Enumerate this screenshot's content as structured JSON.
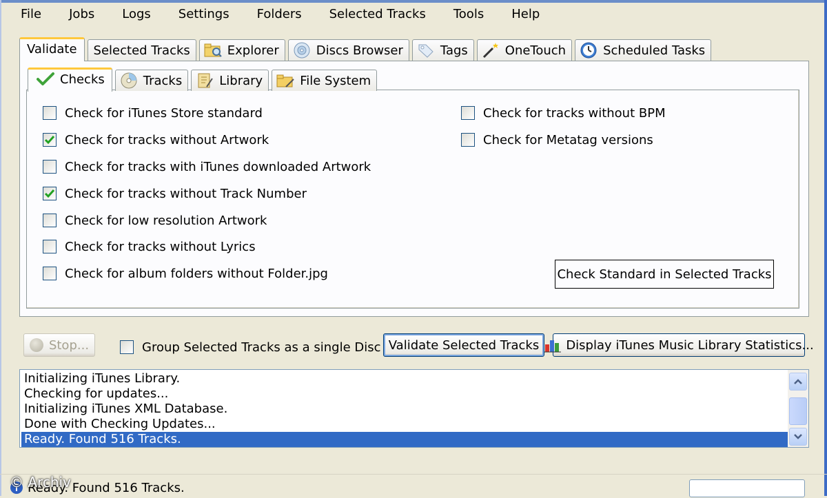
{
  "menu": [
    "File",
    "Jobs",
    "Logs",
    "Settings",
    "Folders",
    "Selected Tracks",
    "Tools",
    "Help"
  ],
  "outer_tabs": [
    {
      "label": "Validate",
      "icon": "none",
      "active": true
    },
    {
      "label": "Selected Tracks",
      "icon": "none"
    },
    {
      "label": "Explorer",
      "icon": "explorer-icon"
    },
    {
      "label": "Discs Browser",
      "icon": "disc-icon"
    },
    {
      "label": "Tags",
      "icon": "tag-icon"
    },
    {
      "label": "OneTouch",
      "icon": "magic-wand-icon"
    },
    {
      "label": "Scheduled Tasks",
      "icon": "clock-icon"
    }
  ],
  "inner_tabs": [
    {
      "label": "Checks",
      "icon": "checkmark-icon",
      "active": true
    },
    {
      "label": "Tracks",
      "icon": "cd-icon"
    },
    {
      "label": "Library",
      "icon": "library-icon"
    },
    {
      "label": "File System",
      "icon": "folder-icon"
    }
  ],
  "checks_left": [
    {
      "label": "Check for iTunes Store standard",
      "checked": false
    },
    {
      "label": "Check for tracks without Artwork",
      "checked": true
    },
    {
      "label": "Check for tracks with iTunes downloaded Artwork",
      "checked": false
    },
    {
      "label": "Check for tracks without Track Number",
      "checked": true
    },
    {
      "label": "Check for low resolution Artwork",
      "checked": false
    },
    {
      "label": "Check for tracks without Lyrics",
      "checked": false
    },
    {
      "label": "Check for album folders without Folder.jpg",
      "checked": false
    }
  ],
  "checks_right": [
    {
      "label": "Check for tracks without BPM",
      "checked": false
    },
    {
      "label": "Check for Metatag versions",
      "checked": false
    }
  ],
  "buttons": {
    "check_standard": "Check Standard in Selected Tracks",
    "stop": "Stop...",
    "validate": "Validate Selected Tracks",
    "stats": "Display iTunes Music Library Statistics..."
  },
  "group_option": {
    "label": "Group Selected Tracks as a single Disc",
    "checked": false
  },
  "log": [
    "Initializing iTunes Library.",
    "Checking for updates...",
    "Initializing iTunes XML Database.",
    "Done with Checking Updates...",
    "Ready. Found 516 Tracks."
  ],
  "log_selected_index": 4,
  "status": {
    "text": "Ready. Found 516 Tracks.",
    "watermark": "© Archiv"
  },
  "colors": {
    "accent": "#316ac5",
    "tab_highlight": "#ffc83c",
    "window_bg": "#ece9d8"
  }
}
